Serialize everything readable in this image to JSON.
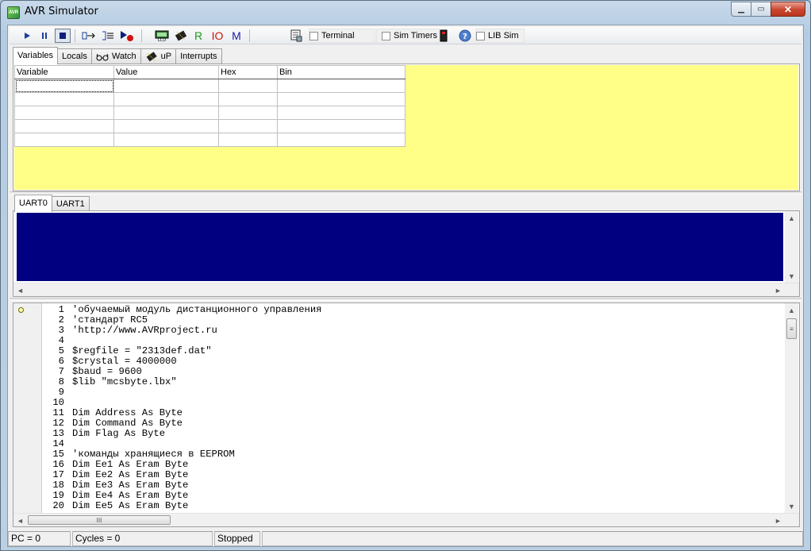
{
  "window": {
    "title": "AVR Simulator",
    "app_icon_text": "AVR"
  },
  "window_buttons": {
    "minimize": "▁",
    "maximize": "▭",
    "close": "✕"
  },
  "toolbar": {
    "run_icon": "play-icon",
    "pause_icon": "pause-icon",
    "stop_icon": "stop-icon",
    "R_label": "R",
    "IO_label": "IO",
    "M_label": "M",
    "terminal_label": "Terminal",
    "sim_timers_label": "Sim Timers",
    "lib_sim_label": "LIB Sim",
    "help_glyph": "?",
    "colors": {
      "R": "#1a9a1a",
      "IO": "#cc1111",
      "M": "#1a1aa8"
    }
  },
  "top_tabs": [
    {
      "label": "Variables",
      "active": true
    },
    {
      "label": "Locals",
      "active": false
    },
    {
      "label": "Watch",
      "active": false,
      "icon": "glasses-icon"
    },
    {
      "label": "uP",
      "active": false,
      "icon": "chip-icon"
    },
    {
      "label": "Interrupts",
      "active": false
    }
  ],
  "variables_table": {
    "headers": [
      "Variable",
      "Value",
      "Hex",
      "Bin"
    ],
    "rows": [
      [
        "",
        "",
        "",
        ""
      ],
      [
        "",
        "",
        "",
        ""
      ],
      [
        "",
        "",
        "",
        ""
      ],
      [
        "",
        "",
        "",
        ""
      ],
      [
        "",
        "",
        "",
        ""
      ]
    ]
  },
  "uart_tabs": [
    {
      "label": "UART0",
      "active": true
    },
    {
      "label": "UART1",
      "active": false
    }
  ],
  "colors": {
    "variables_bg": "#ffff88",
    "uart_bg": "#000080",
    "window_frame": "#b4cce2"
  },
  "code_lines": [
    {
      "n": "1",
      "text": "'обучаемый модуль дистанционного управления"
    },
    {
      "n": "2",
      "text": "'стандарт RC5"
    },
    {
      "n": "3",
      "text": "'http://www.AVRproject.ru"
    },
    {
      "n": "4",
      "text": ""
    },
    {
      "n": "5",
      "text": "$regfile = \"2313def.dat\""
    },
    {
      "n": "6",
      "text": "$crystal = 4000000"
    },
    {
      "n": "7",
      "text": "$baud = 9600"
    },
    {
      "n": "8",
      "text": "$lib \"mcsbyte.lbx\""
    },
    {
      "n": "9",
      "text": ""
    },
    {
      "n": "10",
      "text": ""
    },
    {
      "n": "11",
      "text": "Dim Address As Byte"
    },
    {
      "n": "12",
      "text": "Dim Command As Byte"
    },
    {
      "n": "13",
      "text": "Dim Flag As Byte"
    },
    {
      "n": "14",
      "text": ""
    },
    {
      "n": "15",
      "text": "'команды хранящиеся в EEPROM"
    },
    {
      "n": "16",
      "text": "Dim Ee1 As Eram Byte"
    },
    {
      "n": "17",
      "text": "Dim Ee2 As Eram Byte"
    },
    {
      "n": "18",
      "text": "Dim Ee3 As Eram Byte"
    },
    {
      "n": "19",
      "text": "Dim Ee4 As Eram Byte"
    },
    {
      "n": "20",
      "text": "Dim Ee5 As Eram Byte"
    }
  ],
  "scroll": {
    "left": "◄",
    "right": "►",
    "up": "▲",
    "down": "▼",
    "grip": "III",
    "grip_v": "≡"
  },
  "status": {
    "pc": "PC = 0",
    "cycles": "Cycles = 0",
    "state": "Stopped"
  }
}
